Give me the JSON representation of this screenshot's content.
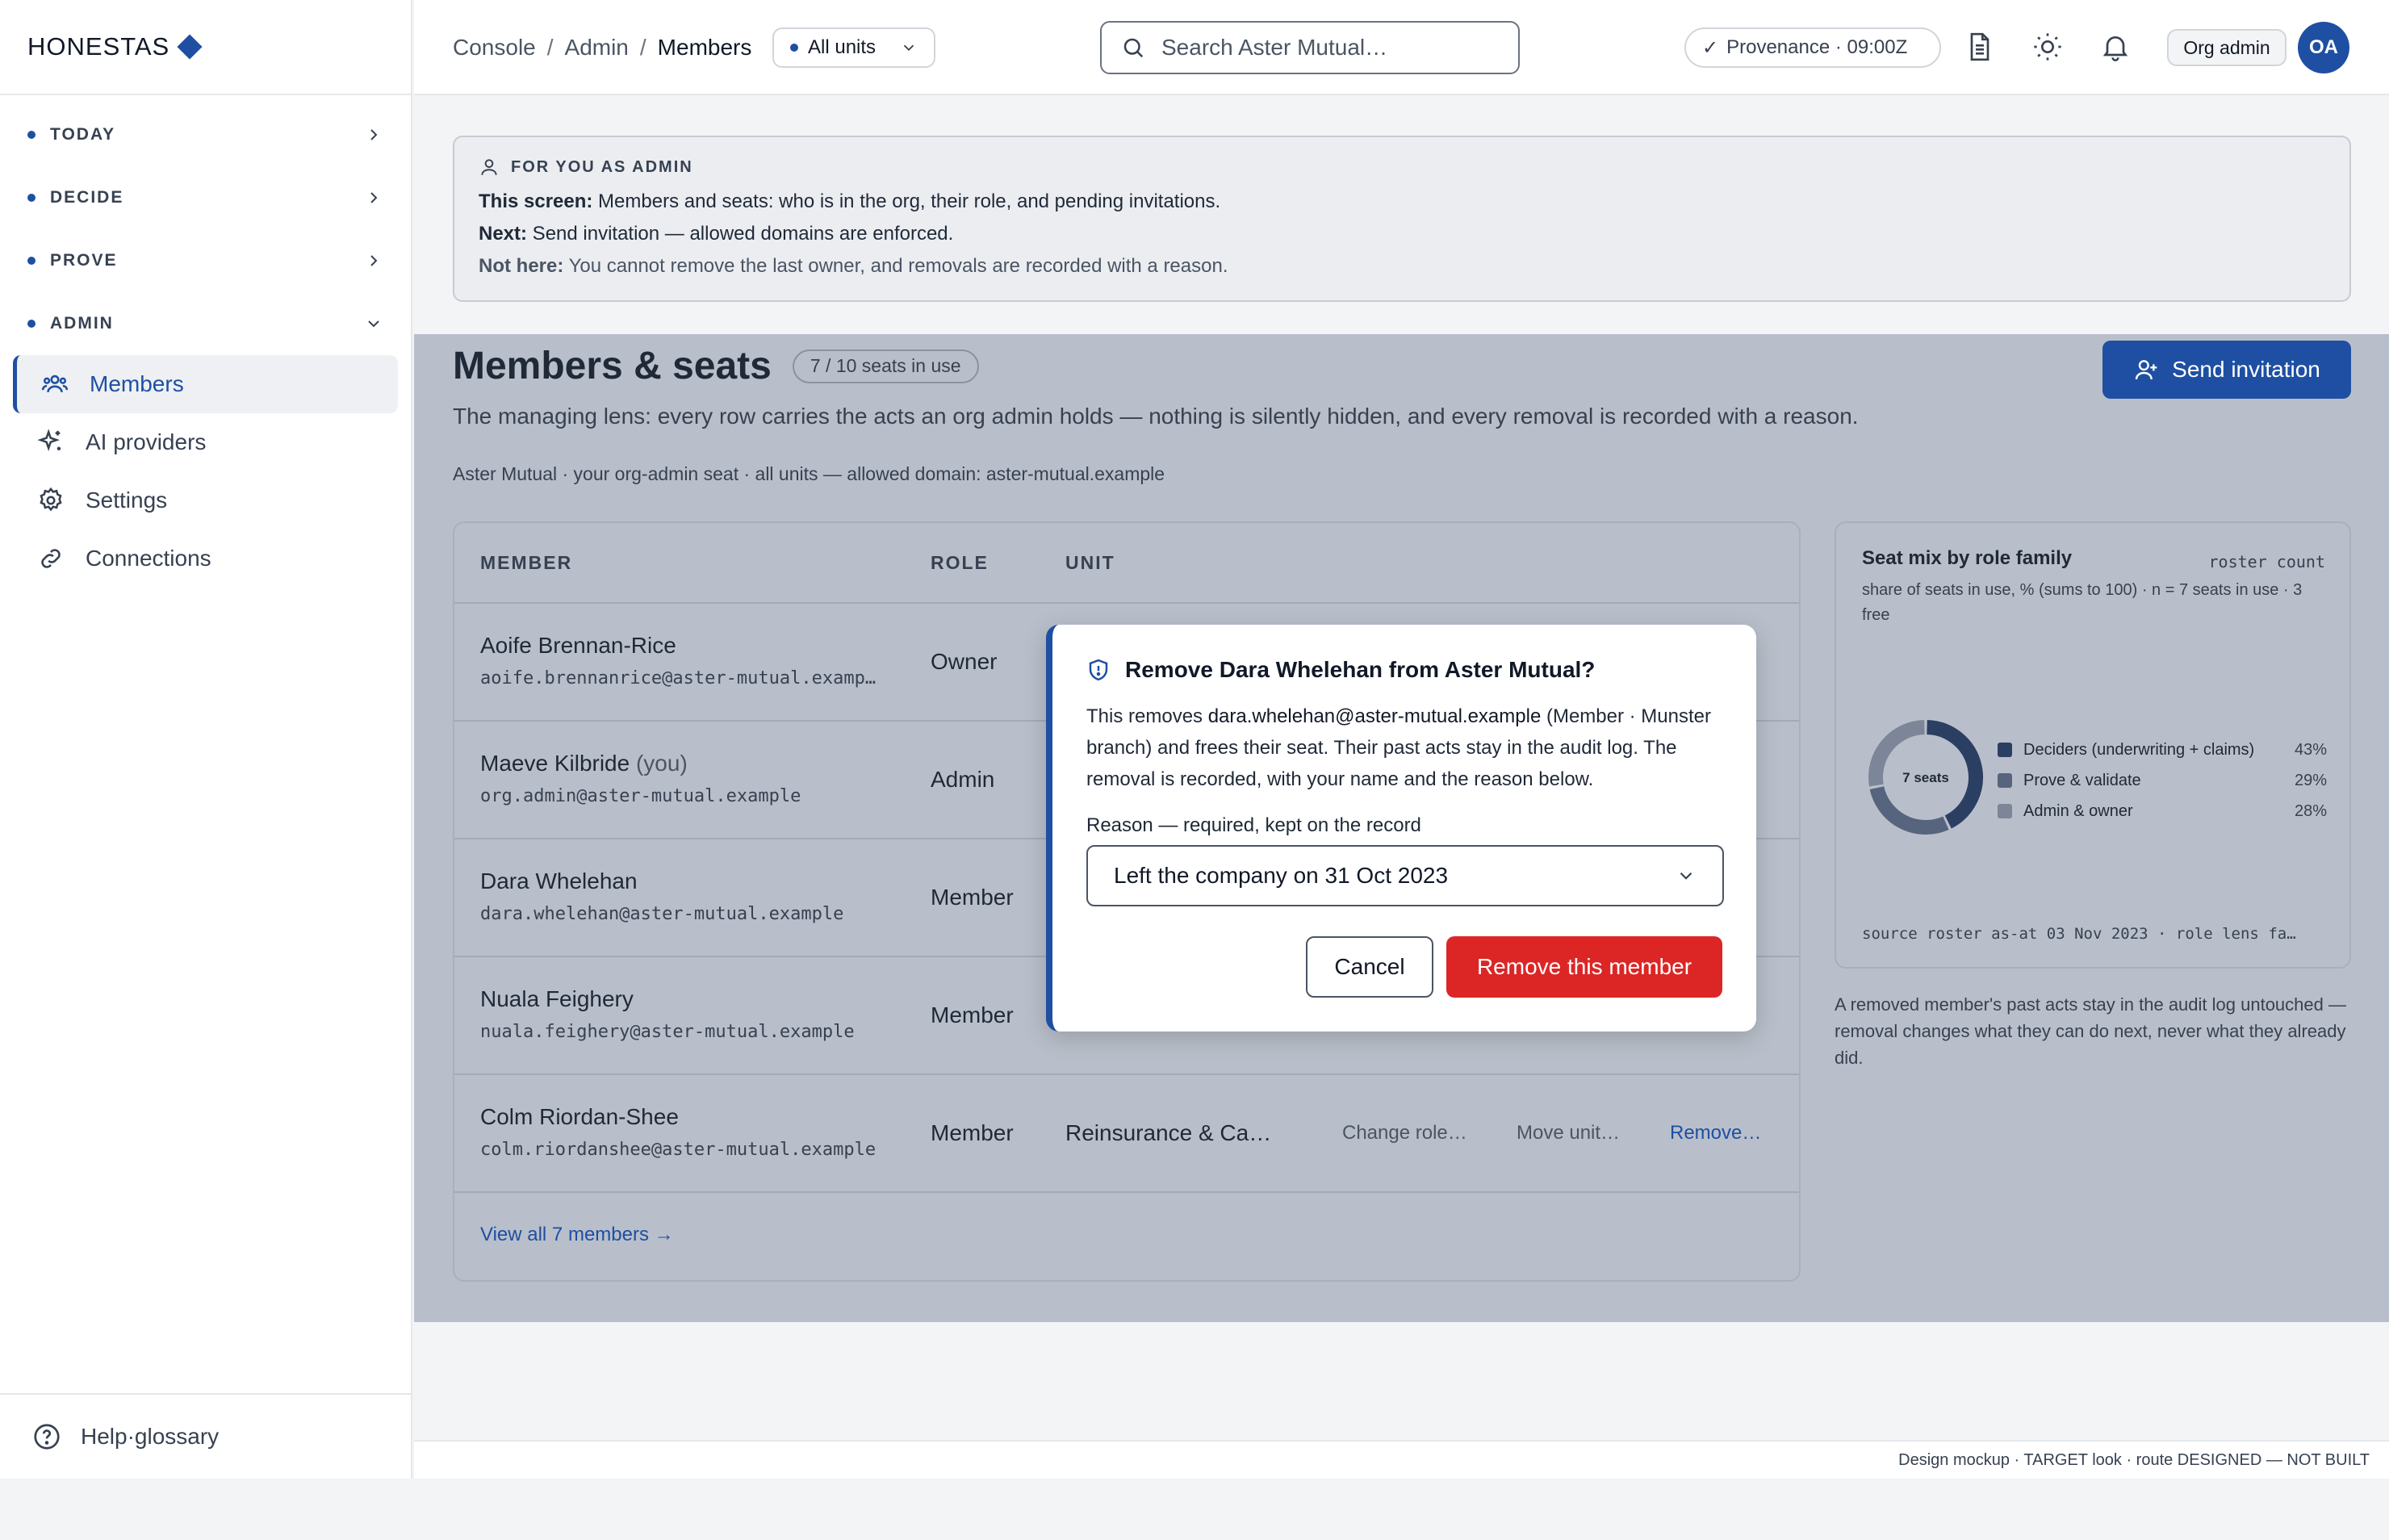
{
  "brand": {
    "name": "HONESTAS"
  },
  "sidebar": {
    "sections": [
      {
        "label": "TODAY"
      },
      {
        "label": "DECIDE"
      },
      {
        "label": "PROVE"
      },
      {
        "label": "ADMIN"
      }
    ],
    "items": [
      {
        "label": "Members",
        "icon": "users-icon",
        "active": true
      },
      {
        "label": "AI providers",
        "icon": "sparkle-icon"
      },
      {
        "label": "Settings",
        "icon": "gear-icon"
      },
      {
        "label": "Connections",
        "icon": "link-icon"
      }
    ],
    "help": {
      "label": "Help·glossary",
      "icon": "help-icon"
    }
  },
  "topbar": {
    "breadcrumb": [
      "Console",
      "Admin",
      "Members"
    ],
    "units_label": "All units",
    "search_placeholder": "Search Aster Mutual…",
    "provenance": "Provenance · 09:00Z",
    "role_badge": "Org admin",
    "avatar_initials": "OA"
  },
  "info": {
    "heading": "FOR YOU AS ADMIN",
    "line1_label": "This screen:",
    "line1_text": " Members and seats: who is in the org, their role, and pending invitations.",
    "line2_label": "Next:",
    "line2_text": " Send invitation — allowed domains are enforced.",
    "line3_label": "Not here:",
    "line3_text": " You cannot remove the last owner, and removals are recorded with a reason."
  },
  "page": {
    "title": "Members & seats",
    "seats_badge": "7 / 10 seats in use",
    "lede": "The managing lens: every row carries the acts an org admin holds — nothing is silently hidden, and every removal is recorded with a reason.",
    "meta": "Aster Mutual · your org-admin seat · all units — allowed domain: aster-mutual.example",
    "send_invitation": "Send invitation"
  },
  "table": {
    "headers": {
      "member": "MEMBER",
      "role": "ROLE",
      "unit": "UNIT"
    },
    "rows": [
      {
        "name": "Aoife Brennan-Rice",
        "you": "",
        "email": "aoife.brennanrice@aster-mutual.examp…",
        "role": "Owner",
        "unit": "",
        "change": "",
        "move": "",
        "remove": ""
      },
      {
        "name": "Maeve Kilbride",
        "you": " (you)",
        "email": "org.admin@aster-mutual.example",
        "role": "Admin",
        "unit": "",
        "change": "",
        "move": "",
        "remove": ""
      },
      {
        "name": "Dara Whelehan",
        "you": "",
        "email": "dara.whelehan@aster-mutual.example",
        "role": "Member",
        "unit": "",
        "change": "",
        "move": "",
        "remove": ""
      },
      {
        "name": "Nuala Feighery",
        "you": "",
        "email": "nuala.feighery@aster-mutual.example",
        "role": "Member",
        "unit": "",
        "change": "",
        "move": "",
        "remove": ""
      },
      {
        "name": "Colm Riordan-Shee",
        "you": "",
        "email": "colm.riordanshee@aster-mutual.example",
        "role": "Member",
        "unit": "Reinsurance & Ca…",
        "change": "Change role…",
        "move": "Move unit…",
        "remove": "Remove…"
      }
    ],
    "view_all": "View all 7 members →"
  },
  "chart": {
    "title": "Seat mix by role family",
    "corner": "roster count",
    "subtitle": "share of seats in use, % (sums to 100) · n = 7 seats in use · 3 free",
    "center_label": "7 seats",
    "source": "source roster as-at 03 Nov 2023 · role lens fa…"
  },
  "chart_data": {
    "type": "pie",
    "categories": [
      "Deciders (underwriting + claims)",
      "Prove & validate",
      "Admin & owner"
    ],
    "values": [
      43,
      29,
      28
    ],
    "colors": [
      "#2b3f63",
      "#56647d",
      "#7c8698"
    ],
    "value_labels": [
      "43%",
      "29%",
      "28%"
    ],
    "title": "Seat mix by role family",
    "legend": "right"
  },
  "footnote": "A removed member's past acts stay in the audit log untouched — removal changes what they can do next, never what they already did.",
  "modal": {
    "title": "Remove Dara Whelehan from Aster Mutual?",
    "body_pre": "This removes ",
    "body_email": "dara.whelehan@aster-mutual.example",
    "body_post": " (Member · Munster branch) and frees their seat. Their past acts stay in the audit log. The removal is recorded, with your name and the reason below.",
    "reason_label": "Reason — required, kept on the record",
    "reason_value": "Left the company on 31 Oct 2023",
    "cancel": "Cancel",
    "confirm": "Remove this member"
  },
  "footer": {
    "text": "Design mockup · TARGET look · route DESIGNED — NOT BUILT"
  }
}
